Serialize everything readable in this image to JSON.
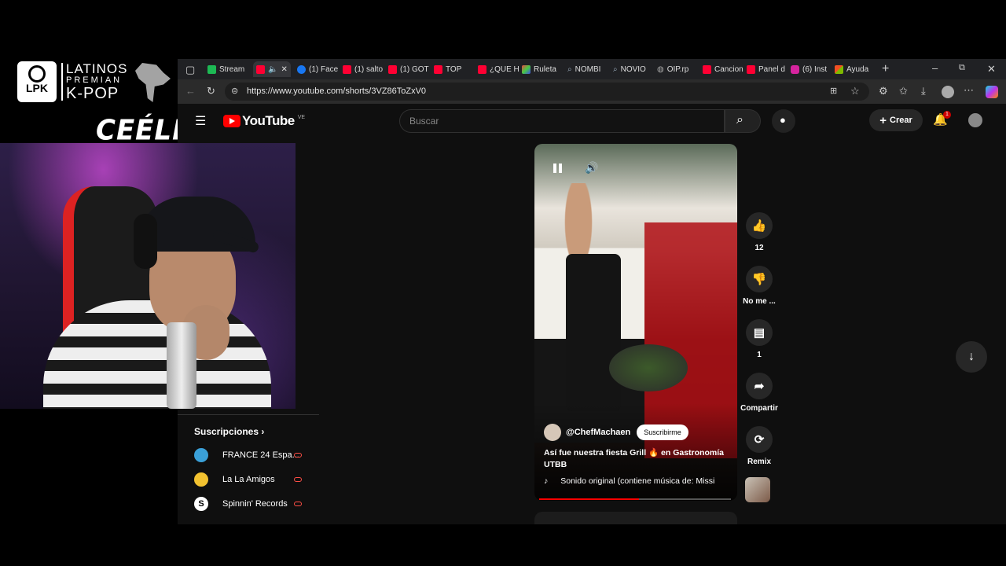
{
  "overlay": {
    "logo_lpk": "LPK",
    "logo_line1": "LATINOS",
    "logo_line2": "PREMIAN",
    "logo_line3": "K-POP",
    "streamer_tag": "CEÉLE"
  },
  "browser": {
    "tabs": [
      {
        "label": "Stream",
        "color": "#1db954"
      },
      {
        "label": "",
        "color": "#ff0033"
      },
      {
        "label": "(1) Face",
        "color": "#1877f2"
      },
      {
        "label": "(1) salto",
        "color": "#ff0033"
      },
      {
        "label": "(1) GOT",
        "color": "#ff0033"
      },
      {
        "label": "TOP",
        "color": "#ff0033"
      },
      {
        "label": "¿QUE H",
        "color": "#ff0033"
      },
      {
        "label": "Ruleta",
        "color": "#e44"
      },
      {
        "label": "NOMBI",
        "color": "#888"
      },
      {
        "label": "NOVIO",
        "color": "#888"
      },
      {
        "label": "OIP.rp",
        "color": "#888"
      },
      {
        "label": "Cancion",
        "color": "#ff0033"
      },
      {
        "label": "Panel d",
        "color": "#ff0033"
      },
      {
        "label": "(6) Inst",
        "color": "#d6249f"
      },
      {
        "label": "Ayuda",
        "color": "#f4b400"
      }
    ],
    "url": "https://www.youtube.com/shorts/3VZ86ToZxV0"
  },
  "youtube": {
    "logo_text": "YouTube",
    "country": "VE",
    "search_placeholder": "Buscar",
    "create_label": "Crear",
    "notifications_count": "1",
    "subscriptions_title": "Suscripciones",
    "subscriptions": [
      {
        "name": "FRANCE 24 Espa...",
        "color": "#3aa0d8"
      },
      {
        "name": "La La Amigos",
        "color": "#f2c230"
      },
      {
        "name": "Spinnin' Records",
        "color": "#222"
      }
    ]
  },
  "short": {
    "channel": "@ChefMachaen",
    "subscribe_label": "Suscribirme",
    "caption": "Así fue nuestra fiesta Grill 🔥 en Gastronomía UTBB",
    "sound_text": "Sonido original (contiene música de: Missi",
    "progress": 0.52,
    "likes": "12",
    "dislike_label": "No me ...",
    "comments": "1",
    "share_label": "Compartir",
    "remix_label": "Remix"
  }
}
